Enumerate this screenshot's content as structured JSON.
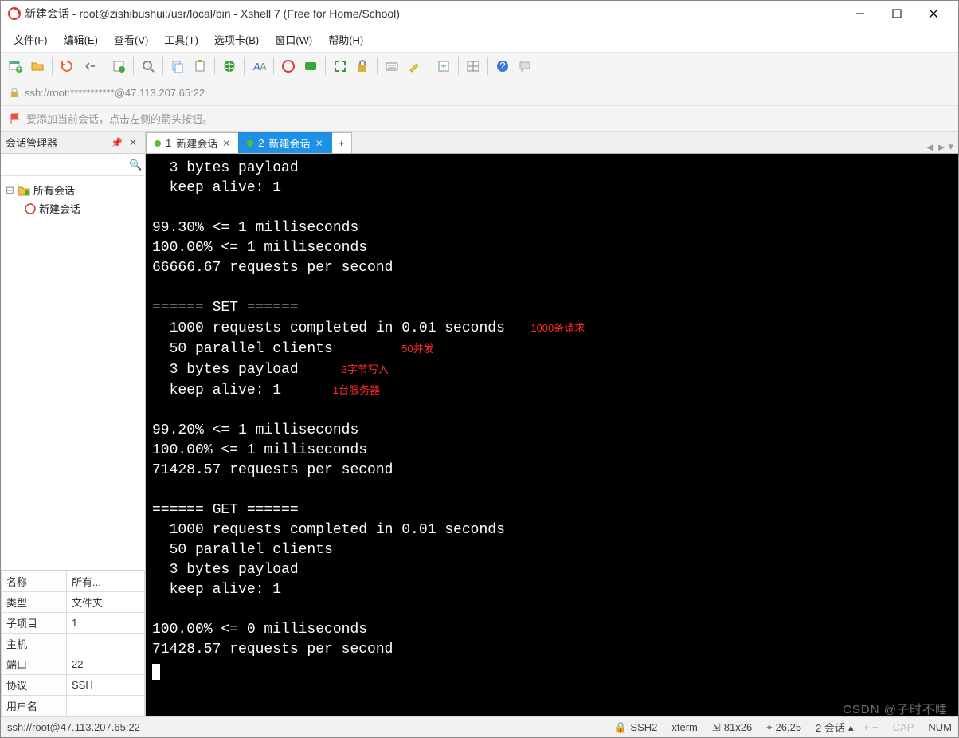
{
  "window": {
    "title": "新建会话 - root@zishibushui:/usr/local/bin - Xshell 7 (Free for Home/School)"
  },
  "menu": {
    "file": "文件(F)",
    "edit": "编辑(E)",
    "view": "查看(V)",
    "tools": "工具(T)",
    "tabs": "选项卡(B)",
    "window": "窗口(W)",
    "help": "帮助(H)"
  },
  "address": {
    "url": "ssh://root:***********@47.113.207.65:22"
  },
  "hint": {
    "text": "要添加当前会话，点击左侧的箭头按钮。"
  },
  "sidebar": {
    "title": "会话管理器",
    "search_placeholder": "",
    "tree": {
      "root": "所有会话",
      "child": "新建会话"
    },
    "props": {
      "name_label": "名称",
      "name_value": "所有...",
      "type_label": "类型",
      "type_value": "文件夹",
      "subitems_label": "子项目",
      "subitems_value": "1",
      "host_label": "主机",
      "host_value": "",
      "port_label": "端口",
      "port_value": "22",
      "protocol_label": "协议",
      "protocol_value": "SSH",
      "user_label": "用户名",
      "user_value": ""
    }
  },
  "tabs": {
    "t1": {
      "num": "1",
      "label": "新建会话",
      "dotcolor": "#5dbb2f"
    },
    "t2": {
      "num": "2",
      "label": "新建会话",
      "dotcolor": "#5dbb2f"
    }
  },
  "terminal": {
    "lines": [
      "  3 bytes payload",
      "  keep alive: 1",
      "",
      "99.30% <= 1 milliseconds",
      "100.00% <= 1 milliseconds",
      "66666.67 requests per second",
      "",
      "====== SET ======"
    ],
    "set_req": "  1000 requests completed in 0.01 seconds",
    "anno_req": "1000条请求",
    "set_clients": "  50 parallel clients",
    "anno_clients": "50并发",
    "set_bytes": "  3 bytes payload",
    "anno_bytes": "3字节写入",
    "set_keep": "  keep alive: 1",
    "anno_server": "1台服务器",
    "after_set": [
      "",
      "99.20% <= 1 milliseconds",
      "100.00% <= 1 milliseconds",
      "71428.57 requests per second",
      "",
      "====== GET ======",
      "  1000 requests completed in 0.01 seconds",
      "  50 parallel clients",
      "  3 bytes payload",
      "  keep alive: 1",
      "",
      "100.00% <= 0 milliseconds",
      "71428.57 requests per second"
    ]
  },
  "status": {
    "conn": "ssh://root@47.113.207.65:22",
    "proto": "SSH2",
    "term": "xterm",
    "size": "81x26",
    "cursor": "26,25",
    "sessions": "2 会话",
    "caps": "CAP",
    "num": "NUM"
  },
  "watermark": "CSDN @子时不睡"
}
